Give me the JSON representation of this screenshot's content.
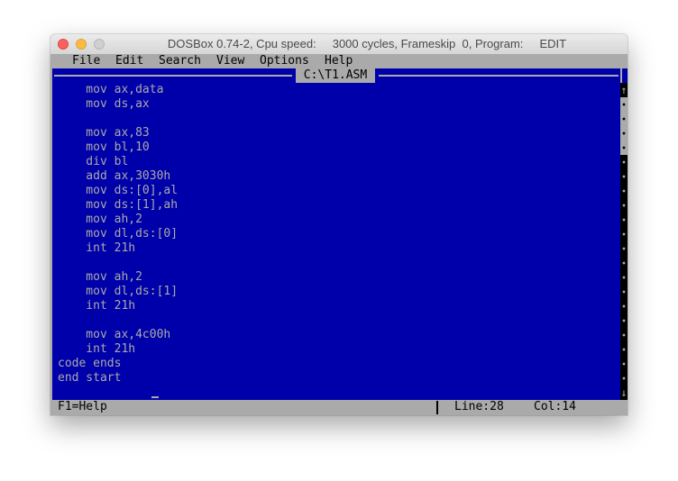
{
  "window": {
    "title": "DOSBox 0.74-2, Cpu speed:     3000 cycles, Frameskip  0, Program:     EDIT"
  },
  "menu": {
    "items": [
      "File",
      "Edit",
      "Search",
      "View",
      "Options",
      "Help"
    ]
  },
  "editor": {
    "filename": "C:\\T1.ASM",
    "lines": [
      "    mov ax,data",
      "    mov ds,ax",
      "",
      "    mov ax,83",
      "    mov bl,10",
      "    div bl",
      "    add ax,3030h",
      "    mov ds:[0],al",
      "    mov ds:[1],ah",
      "    mov ah,2",
      "    mov dl,ds:[0]",
      "    int 21h",
      "",
      "    mov ah,2",
      "    mov dl,ds:[1]",
      "    int 21h",
      "",
      "    mov ax,4c00h",
      "    int 21h",
      "code ends",
      "end start"
    ]
  },
  "scrollbar": {
    "up_arrow": "↑",
    "down_arrow": "↓"
  },
  "status": {
    "help": "F1=Help",
    "line": "Line:28",
    "col": "Col:14"
  },
  "colors": {
    "background": "#0000aa",
    "foreground": "#aaaaaa",
    "bar": "#aaaaaa"
  }
}
